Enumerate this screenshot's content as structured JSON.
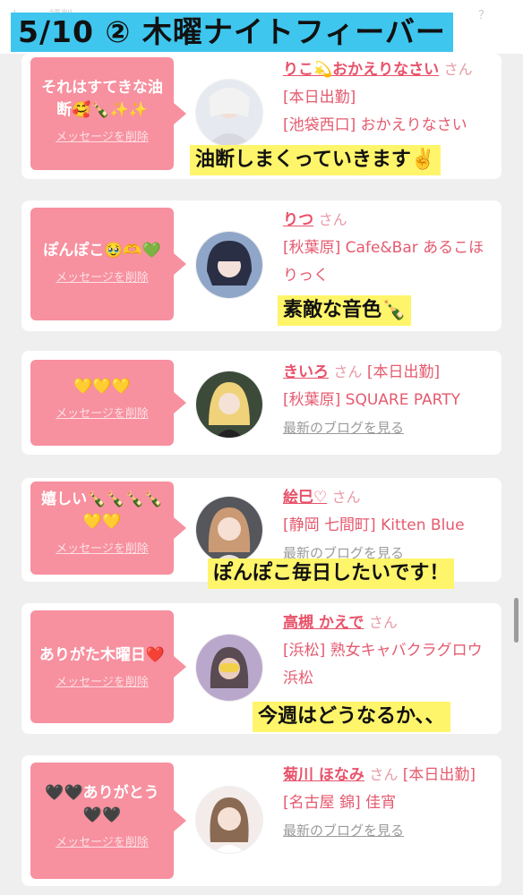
{
  "header": {
    "title": "5/10 ② 木曜ナイトフィーバー",
    "faint_left": "ﾄ 〜 ｏ評判",
    "faint_right": "？"
  },
  "common": {
    "delete_label": "メッセージを削除",
    "san": "さん",
    "blog_label": "最新のブログを見る"
  },
  "cards": [
    {
      "message": "それはすてきな油断🥰🍾✨✨",
      "name": "りこ💫おかえりなさい",
      "line1_suffix": "[本日出勤]",
      "line2": "[池袋西口] おかえりなさい",
      "comment": "油断しまくっていきます✌️"
    },
    {
      "message": "ぽんぽこ🥹🫶💚",
      "name": "りつ",
      "line1_suffix": "",
      "line2": "[秋葉原] Cafe&Bar あるこほりっく",
      "comment": "素敵な音色🍾"
    },
    {
      "message": "💛💛💛",
      "name": "きいろ",
      "line1_suffix": "[本日出勤]",
      "line2": "[秋葉原] SQUARE PARTY",
      "comment": ""
    },
    {
      "message": "嬉しい🍾🍾🍾🍾💛💛",
      "name": "絵巳♡",
      "line1_suffix": "",
      "line2": "[静岡 七間町] Kitten Blue",
      "comment": "ぽんぽこ毎日したいです！"
    },
    {
      "message": "ありがた木曜日❤️",
      "name": "高槻 かえで",
      "line1_suffix": "",
      "line2": "[浜松] 熟女キャバクラグロウ 浜松",
      "comment": "今週はどうなるか、、"
    },
    {
      "message": "🖤🖤ありがとう🖤🖤",
      "name": "菊川 ほなみ",
      "line1_suffix": "[本日出勤]",
      "line2": "[名古屋 錦] 佳宵",
      "comment": ""
    }
  ]
}
